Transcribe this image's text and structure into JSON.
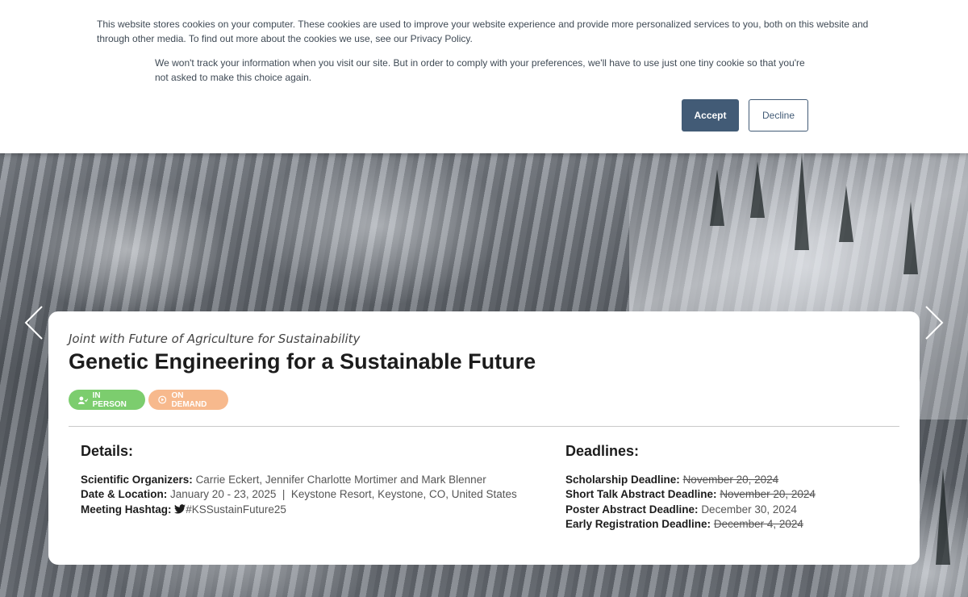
{
  "cookie_banner": {
    "text_1": "This website stores cookies on your computer. These cookies are used to improve your website experience and provide more personalized services to you, both on this website and through other media. To find out more about the cookies we use, see our Privacy Policy.",
    "text_2": "We won't track your information when you visit our site. But in order to comply with your preferences, we'll have to use just one tiny cookie so that you're not asked to make this choice again.",
    "accept_label": "Accept",
    "decline_label": "Decline",
    "accent_color": "#425b76"
  },
  "carousel": {
    "prev_icon": "chevron-left-icon",
    "next_icon": "chevron-right-icon"
  },
  "event": {
    "subtitle": "Joint with Future of Agriculture for Sustainability",
    "title": "Genetic Engineering for a Sustainable Future",
    "badges": [
      {
        "label": "IN PERSON",
        "icon": "person-icon",
        "color": "#7ccd6e"
      },
      {
        "label": "ON DEMAND",
        "icon": "play-circle-icon",
        "color": "#f7b98d"
      }
    ],
    "details": {
      "heading": "Details:",
      "organizers_label": "Scientific Organizers:",
      "organizers_value": "Carrie Eckert, Jennifer Charlotte Mortimer and Mark Blenner",
      "date_location_label": "Date & Location:",
      "date_location_value": "January 20 - 23, 2025  |  Keystone Resort, Keystone, CO, United States",
      "hashtag_label": "Meeting Hashtag:",
      "hashtag_value": "#KSSustainFuture25"
    },
    "deadlines": {
      "heading": "Deadlines:",
      "items": [
        {
          "label": "Scholarship Deadline:",
          "value": "November 20, 2024",
          "struck": true
        },
        {
          "label": "Short Talk Abstract Deadline:",
          "value": "November 20, 2024",
          "struck": true
        },
        {
          "label": "Poster Abstract Deadline:",
          "value": "December 30, 2024",
          "struck": false
        },
        {
          "label": "Early Registration Deadline:",
          "value": "December 4, 2024",
          "struck": true
        }
      ]
    }
  }
}
